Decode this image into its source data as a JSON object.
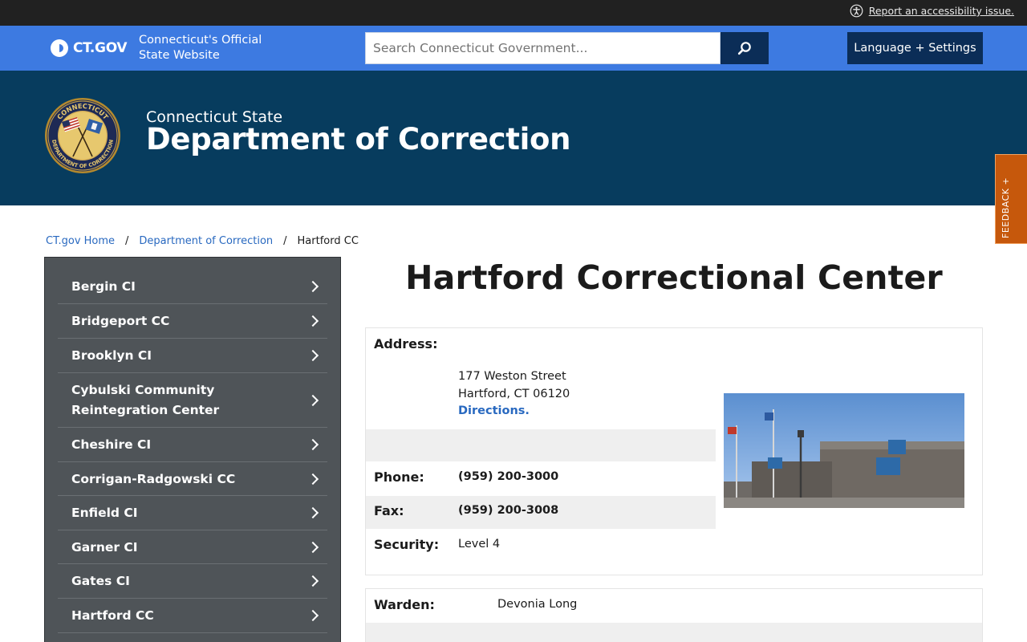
{
  "utility": {
    "accessibility_link": "Report an accessibility issue."
  },
  "header": {
    "logo_text": "CT.GOV",
    "tagline_line1": "Connecticut's Official",
    "tagline_line2": "State Website",
    "search_placeholder": "Search Connecticut Government...",
    "language_button": "Language + Settings"
  },
  "agency": {
    "kicker": "Connecticut State",
    "title": "Department of Correction",
    "seal_text": "CONNECTICUT DEPARTMENT OF CORRECTION"
  },
  "feedback": {
    "label": "FEEDBACK +"
  },
  "breadcrumb": {
    "items": [
      "CT.gov Home",
      "Department of Correction",
      "Hartford CC"
    ],
    "separator": "/"
  },
  "sidenav": {
    "items": [
      {
        "label": "Bergin CI"
      },
      {
        "label": "Bridgeport CC"
      },
      {
        "label": "Brooklyn CI"
      },
      {
        "label": "Cybulski Community Reintegration Center"
      },
      {
        "label": "Cheshire CI"
      },
      {
        "label": "Corrigan-Radgowski CC"
      },
      {
        "label": "Enfield CI"
      },
      {
        "label": "Garner CI"
      },
      {
        "label": "Gates CI"
      },
      {
        "label": "Hartford CC"
      }
    ]
  },
  "main": {
    "title": "Hartford Correctional Center",
    "address_label": "Address:",
    "address_line1": "177 Weston Street",
    "address_line2": "Hartford, CT 06120",
    "directions": "Directions.",
    "phone_label": "Phone:",
    "phone": "(959) 200-3000",
    "fax_label": "Fax:",
    "fax": "(959) 200-3008",
    "security_label": "Security:",
    "security": "Level 4",
    "warden_label": "Warden:",
    "warden": "Devonia Long"
  },
  "colors": {
    "utility_bar": "#212121",
    "ct_blue": "#3d7ae1",
    "navy": "#0b2d57",
    "agency_banner": "#073c5e",
    "sidenav": "#4f5458",
    "link": "#2969c0",
    "feedback": "#c6580c"
  },
  "icons": {
    "accessibility": "accessibility-icon",
    "search": "magnifier-icon",
    "chevron": "chevron-right-icon"
  }
}
